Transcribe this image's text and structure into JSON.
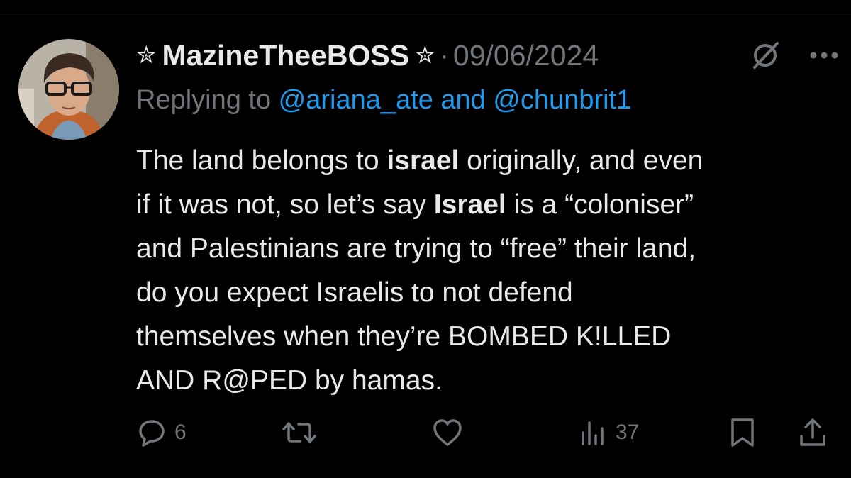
{
  "tweet": {
    "display_name": "MazineTheeBOSS",
    "name_prefix_symbol": "✮",
    "name_suffix_symbol": "✮",
    "separator": "·",
    "date": "09/06/2024",
    "replying_prefix": "Replying to ",
    "replying_mentions": "@ariana_ate and @chunbrit1",
    "body": {
      "l1a": "The land belongs to ",
      "l1b": "israel",
      "l1c": " originally, and even",
      "l2a": "if it was not, so let’s say ",
      "l2b": "Israel",
      "l2c": " is a “coloniser”",
      "l3": "and Palestinians are trying to “free” their land,",
      "l4": "do you expect Israelis to not defend",
      "l5": "themselves when they’re BOMBED K!LLED",
      "l6": "AND R@PED by hamas."
    }
  },
  "actions": {
    "reply_count": "6",
    "repost_count": "",
    "like_count": "",
    "views_count": "37"
  },
  "icons": {
    "grok": "grok-icon",
    "more": "more-icon",
    "reply": "reply-icon",
    "repost": "repost-icon",
    "like": "like-icon",
    "views": "views-icon",
    "bookmark": "bookmark-icon",
    "share": "share-icon"
  },
  "colors": {
    "background": "#000000",
    "text_primary": "#e7e9ea",
    "text_secondary": "#71767b",
    "mention": "#1d9bf0"
  }
}
